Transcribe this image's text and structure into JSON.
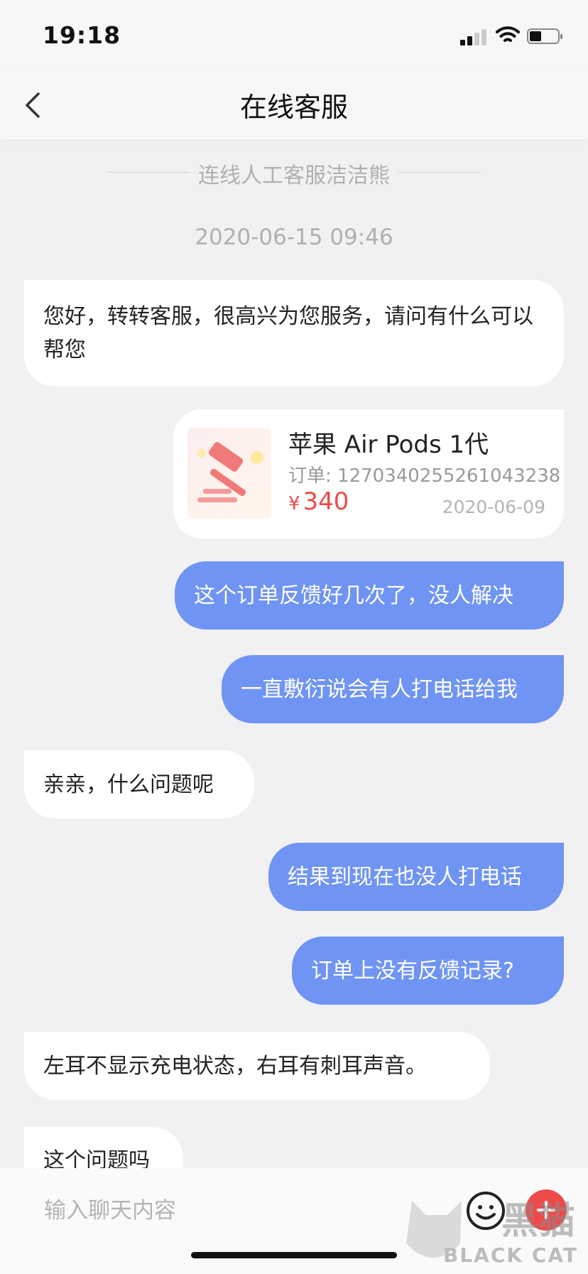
{
  "status_bar": {
    "time": "19:18"
  },
  "header": {
    "title": "在线客服"
  },
  "chat": {
    "system_notice": "连线人工客服洁洁熊",
    "timestamp": "2020-06-15 09:46",
    "messages": [
      {
        "side": "left",
        "text": "您好，转转客服，很高兴为您服务，请问有什么可以帮您"
      },
      {
        "side": "right",
        "text": "这个订单反馈好几次了，没人解决"
      },
      {
        "side": "right",
        "text": "一直敷衍说会有人打电话给我"
      },
      {
        "side": "left",
        "text": "亲亲，什么问题呢"
      },
      {
        "side": "right",
        "text": "结果到现在也没人打电话"
      },
      {
        "side": "right",
        "text": "订单上没有反馈记录?"
      },
      {
        "side": "left",
        "text": "左耳不显示充电状态，右耳有刺耳声音。"
      },
      {
        "side": "left",
        "text": "这个问题吗"
      }
    ],
    "order_card": {
      "product_name": "苹果 Air Pods 1代",
      "order_number": "订单: 1270340255261043238",
      "currency": "¥",
      "price": "340",
      "date": "2020-06-09"
    }
  },
  "input": {
    "placeholder": "输入聊天内容"
  },
  "watermark": {
    "cn": "黑猫",
    "en": "BLACK CAT"
  },
  "colors": {
    "accent_blue": "#6f94f3",
    "price_red": "#ef4a4a",
    "background": "#f1f1f3"
  }
}
